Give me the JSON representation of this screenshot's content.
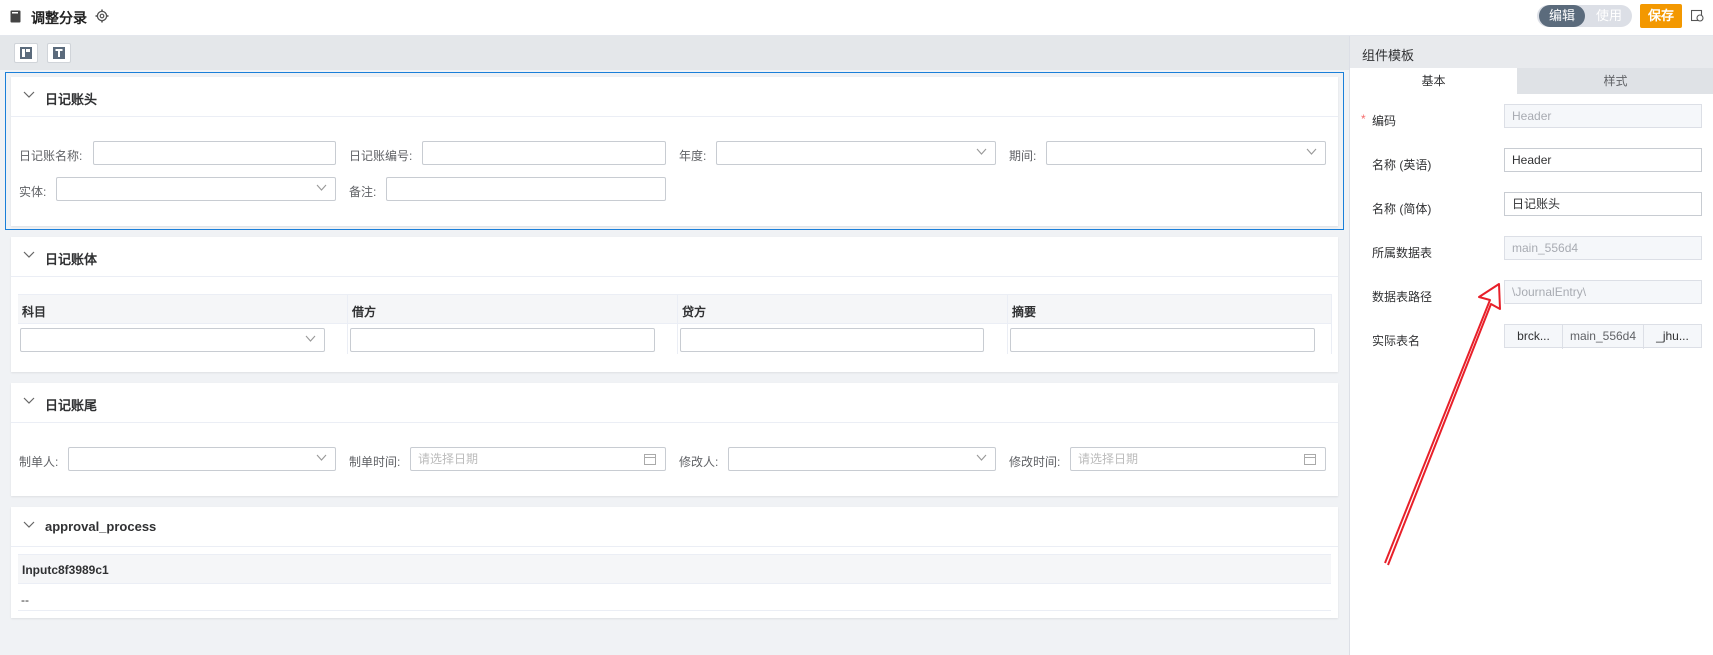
{
  "app": {
    "title": "调整分录",
    "mode_edit": "编辑",
    "mode_use": "使用",
    "save_label": "保存"
  },
  "colors": {
    "accent": "#f39800",
    "selected_outline": "#1a7fd9",
    "annotation_arrow": "#e8202a"
  },
  "sections": {
    "header": {
      "title": "日记账头",
      "fields": {
        "journal_name": "日记账名称:",
        "journal_no": "日记账编号:",
        "year": "年度:",
        "period": "期间:",
        "entity": "实体:",
        "remark": "备注:"
      }
    },
    "body": {
      "title": "日记账体",
      "columns": [
        "科目",
        "借方",
        "贷方",
        "摘要"
      ]
    },
    "footer": {
      "title": "日记账尾",
      "fields": {
        "creator": "制单人:",
        "created_time": "制单时间:",
        "modifier": "修改人:",
        "modified_time": "修改时间:"
      },
      "date_placeholder": "请选择日期"
    },
    "approval": {
      "title": "approval_process",
      "column": "Inputc8f3989c1",
      "value": "--"
    }
  },
  "panel": {
    "title": "组件模板",
    "tabs": [
      "基本",
      "样式"
    ],
    "props": {
      "code_label": "编码",
      "code_value": "Header",
      "name_en_label": "名称 (英语)",
      "name_en_value": "Header",
      "name_zh_label": "名称 (简体)",
      "name_zh_value": "日记账头",
      "table_label": "所属数据表",
      "table_value": "main_556d4",
      "path_label": "数据表路径",
      "path_value": "\\JournalEntry\\",
      "actual_label": "实际表名",
      "actual_parts": [
        "brck...",
        "main_556d4",
        "_jhu..."
      ]
    }
  },
  "icons": {
    "book": "book-icon",
    "gear": "gear-icon",
    "preview": "preview-icon",
    "layout": "layout-icon",
    "text": "text-icon",
    "chevron": "chevron-down-icon",
    "calendar": "calendar-icon"
  }
}
